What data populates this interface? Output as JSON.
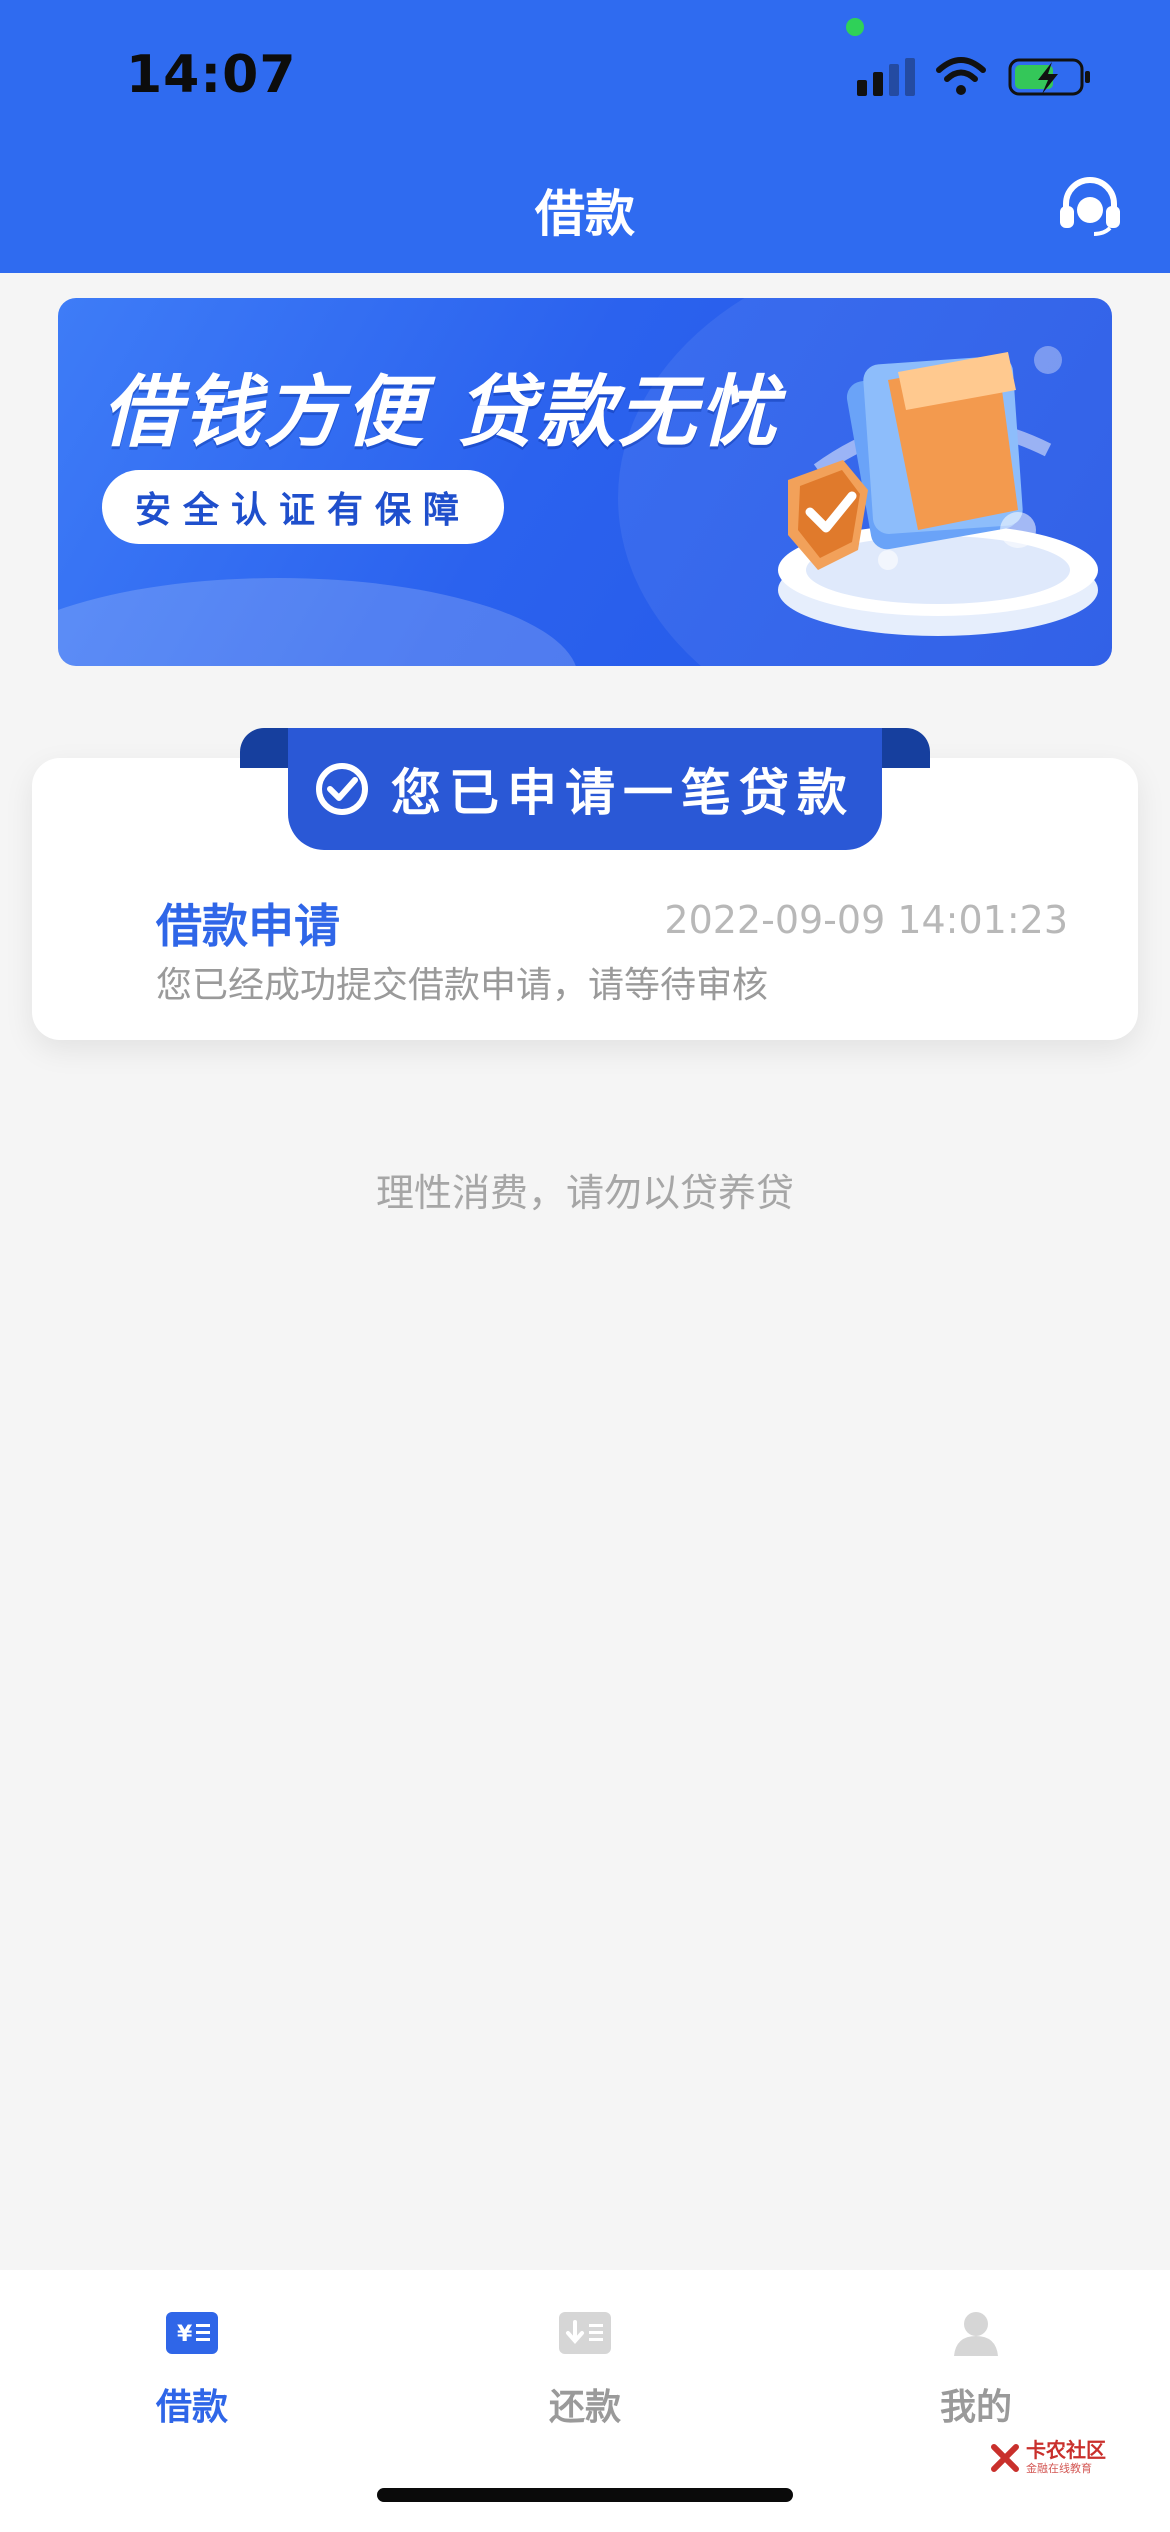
{
  "status_bar": {
    "time": "14:07"
  },
  "nav": {
    "title": "借款",
    "support_icon": "headset-icon"
  },
  "banner": {
    "headline": "借钱方便  贷款无忧",
    "pill": "安全认证有保障"
  },
  "status_card": {
    "ribbon": "您已申请一笔贷款",
    "title": "借款申请",
    "timestamp": "2022-09-09 14:01:23",
    "description": "您已经成功提交借款申请，请等待审核"
  },
  "tip": "理性消费，请勿以贷养贷",
  "tabbar": {
    "items": [
      {
        "label": "借款",
        "icon": "loan-icon",
        "active": true
      },
      {
        "label": "还款",
        "icon": "repay-icon",
        "active": false
      },
      {
        "label": "我的",
        "icon": "profile-icon",
        "active": false
      }
    ]
  },
  "watermark": {
    "name": "卡农社区",
    "sub": "金融在线教育"
  },
  "colors": {
    "primary": "#2f6bf0",
    "accent_text": "#2f66e8",
    "background": "#f5f5f5"
  }
}
